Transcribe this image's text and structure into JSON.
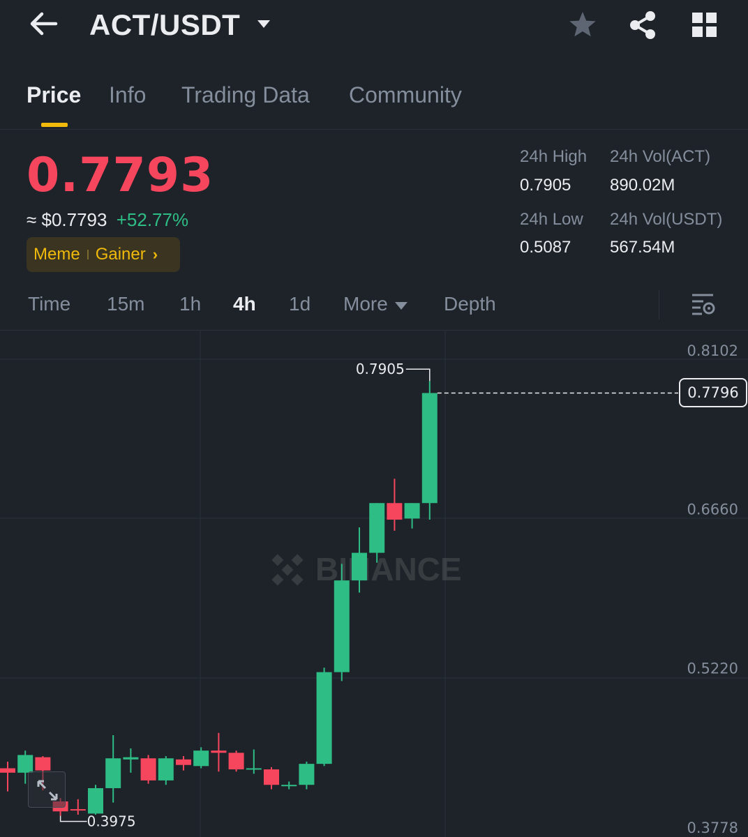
{
  "header": {
    "back_icon": "arrow-left-icon",
    "pair": "ACT/USDT",
    "caret_icon": "caret-down-icon",
    "favorite_icon": "star-icon",
    "share_icon": "share-icon",
    "menu_icon": "grid-icon"
  },
  "tabs": [
    {
      "label": "Price",
      "active": true
    },
    {
      "label": "Info",
      "active": false
    },
    {
      "label": "Trading Data",
      "active": false
    },
    {
      "label": "Community",
      "active": false
    }
  ],
  "ticker": {
    "last_price": "0.7793",
    "usd_price": "≈ $0.7793",
    "change": "+52.77%",
    "tags": [
      "Meme",
      "Gainer"
    ],
    "stats": {
      "high_label": "24h High",
      "high": "0.7905",
      "low_label": "24h Low",
      "low": "0.5087",
      "vol_base_label": "24h Vol(ACT)",
      "vol_base": "890.02M",
      "vol_quote_label": "24h Vol(USDT)",
      "vol_quote": "567.54M"
    }
  },
  "intervals": [
    "Time",
    "15m",
    "1h",
    "4h",
    "1d",
    "More",
    "Depth"
  ],
  "active_interval": "4h",
  "chart_settings_icon": "chart-settings-icon",
  "colors": {
    "up": "#2ebd85",
    "down": "#f6465d",
    "accent": "#f0b90b",
    "background": "#1e2329"
  },
  "chart_data": {
    "type": "candlestick",
    "interval": "4h",
    "y_ticks": [
      0.8102,
      0.666,
      0.522,
      0.3778
    ],
    "ylim": [
      0.3778,
      0.8102
    ],
    "current_price_tag": "0.7796",
    "max_label": "0.7905",
    "min_label": "0.3975",
    "watermark": "BINANCE",
    "candles": [
      {
        "o": 0.44,
        "c": 0.436,
        "h": 0.446,
        "l": 0.419
      },
      {
        "o": 0.436,
        "c": 0.452,
        "h": 0.456,
        "l": 0.426
      },
      {
        "o": 0.45,
        "c": 0.438,
        "h": 0.451,
        "l": 0.42
      },
      {
        "o": 0.41,
        "c": 0.401,
        "h": 0.413,
        "l": 0.397
      },
      {
        "o": 0.403,
        "c": 0.402,
        "h": 0.412,
        "l": 0.398
      },
      {
        "o": 0.399,
        "c": 0.422,
        "h": 0.425,
        "l": 0.398
      },
      {
        "o": 0.422,
        "c": 0.449,
        "h": 0.47,
        "l": 0.409
      },
      {
        "o": 0.448,
        "c": 0.45,
        "h": 0.458,
        "l": 0.436
      },
      {
        "o": 0.449,
        "c": 0.429,
        "h": 0.452,
        "l": 0.426
      },
      {
        "o": 0.429,
        "c": 0.449,
        "h": 0.451,
        "l": 0.425
      },
      {
        "o": 0.448,
        "c": 0.443,
        "h": 0.451,
        "l": 0.438
      },
      {
        "o": 0.442,
        "c": 0.456,
        "h": 0.459,
        "l": 0.44
      },
      {
        "o": 0.456,
        "c": 0.454,
        "h": 0.472,
        "l": 0.437
      },
      {
        "o": 0.454,
        "c": 0.439,
        "h": 0.456,
        "l": 0.437
      },
      {
        "o": 0.439,
        "c": 0.44,
        "h": 0.457,
        "l": 0.435
      },
      {
        "o": 0.439,
        "c": 0.425,
        "h": 0.441,
        "l": 0.421
      },
      {
        "o": 0.424,
        "c": 0.425,
        "h": 0.428,
        "l": 0.421
      },
      {
        "o": 0.425,
        "c": 0.444,
        "h": 0.446,
        "l": 0.421
      },
      {
        "o": 0.444,
        "c": 0.527,
        "h": 0.531,
        "l": 0.442
      },
      {
        "o": 0.527,
        "c": 0.61,
        "h": 0.625,
        "l": 0.519
      },
      {
        "o": 0.61,
        "c": 0.635,
        "h": 0.658,
        "l": 0.599
      },
      {
        "o": 0.635,
        "c": 0.68,
        "h": 0.68,
        "l": 0.626
      },
      {
        "o": 0.68,
        "c": 0.665,
        "h": 0.702,
        "l": 0.655
      },
      {
        "o": 0.666,
        "c": 0.68,
        "h": 0.68,
        "l": 0.657
      },
      {
        "o": 0.68,
        "c": 0.7796,
        "h": 0.7905,
        "l": 0.665
      }
    ]
  }
}
